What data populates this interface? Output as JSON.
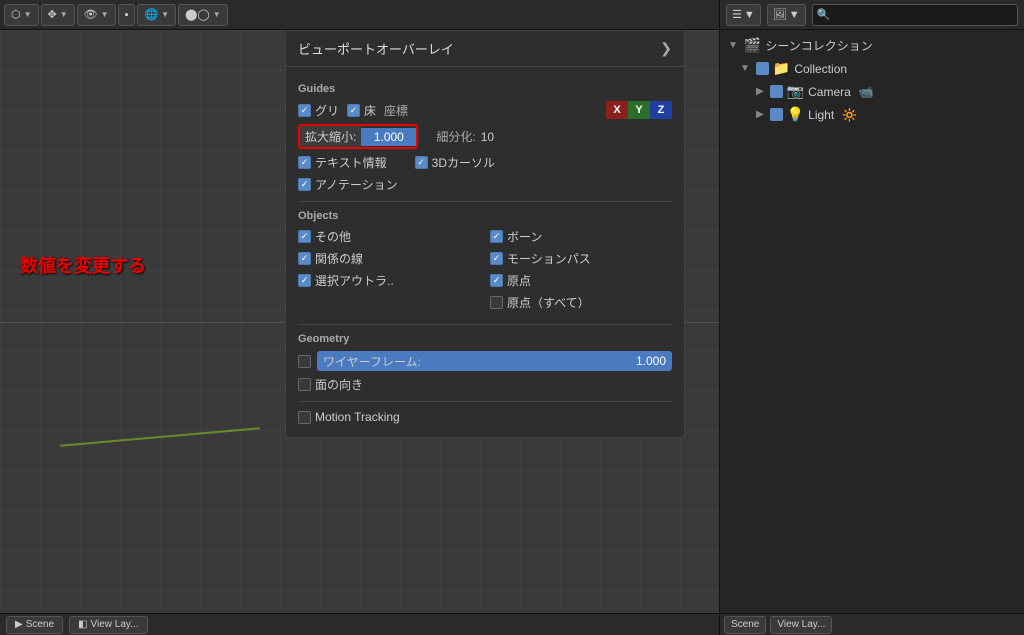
{
  "toolbar": {
    "viewport_btn": "▼",
    "camera_btn": "▼",
    "shading_btn": "▼"
  },
  "overlay": {
    "title": "ビューポートオーバーレイ",
    "close_btn": "❯",
    "guides_label": "Guides",
    "grid_label": "グリ",
    "floor_label": "床",
    "coord_label": "座標",
    "x_btn": "X",
    "y_btn": "Y",
    "z_btn": "Z",
    "scale_label": "拡大縮小:",
    "scale_value": "1.000",
    "subdiv_label": "細分化:",
    "subdiv_value": "10",
    "text_info_label": "テキスト情報",
    "cursor_3d_label": "3Dカーソル",
    "annotation_label": "アノテーション",
    "objects_label": "Objects",
    "other_label": "その他",
    "bone_label": "ボーン",
    "relation_label": "関係の線",
    "motion_path_label": "モーションパス",
    "select_outline_label": "選択アウトラ..",
    "origin_label": "原点",
    "origin_all_label": "原点（すべて）",
    "geometry_label": "Geometry",
    "wireframe_label": "ワイヤーフレーム:",
    "wireframe_value": "1.000",
    "face_orient_label": "面の向き",
    "motion_tracking_label": "Motion Tracking"
  },
  "annotation": {
    "text": "数値を変更する"
  },
  "outliner": {
    "scene_collection_label": "シーンコレクション",
    "collection_label": "Collection",
    "camera_label": "Camera",
    "light_label": "Light",
    "scene_label": "Scene",
    "view_layer_label": "View Lay..."
  },
  "bottom_bar": {
    "scene_btn": "Scene",
    "view_layer_btn": "View Lay..."
  }
}
